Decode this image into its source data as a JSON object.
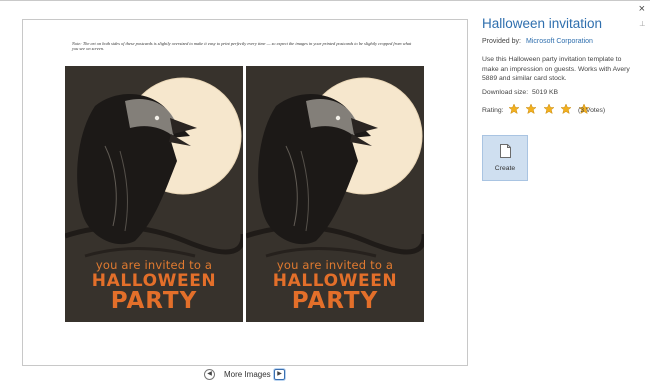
{
  "window": {
    "close_glyph": "×",
    "pin_glyph": "⟂"
  },
  "preview": {
    "note": "Note: The art on both sides of these postcards is slightly oversized to make it easy to print perfectly every time — so expect the images in your printed postcards to be slightly cropped from what you see on screen.",
    "card": {
      "invite_line": "you are invited to a",
      "halloween_line": "HALLOWEEN",
      "party_line": "PARTY"
    },
    "colors": {
      "card_background": "#37322c",
      "moon": "#f6e7cd",
      "accent_orange": "#e36f2a"
    }
  },
  "navigation": {
    "prev_icon": "prev-arrow-icon",
    "next_icon": "next-arrow-icon",
    "label": "More Images"
  },
  "details": {
    "title": "Halloween invitation",
    "provided_by_label": "Provided by:",
    "provider": "Microsoft Corporation",
    "description": "Use this Halloween party invitation template to make an impression on guests. Works with Avery 5889 and similar card stock.",
    "download_size_label": "Download size:",
    "download_size_value": "5019 KB",
    "rating_label": "Rating:",
    "rating_value": 5,
    "rating_max": 5,
    "votes": "(3 Votes)",
    "create_label": "Create",
    "colors": {
      "title": "#2f6fae",
      "star": "#f2b01e",
      "create_bg": "#cfdff0"
    }
  }
}
